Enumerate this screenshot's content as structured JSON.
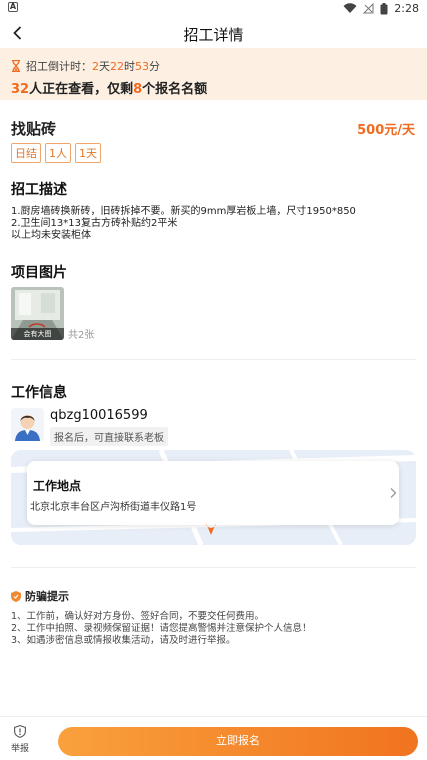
{
  "status_bar": {
    "left_badge": "A",
    "time": "2:28",
    "icons": [
      "wifi-icon",
      "signal-icon",
      "battery-icon"
    ]
  },
  "header": {
    "title": "招工详情",
    "back_icon": "chevron-left-icon"
  },
  "countdown": {
    "label": "招工倒计时：",
    "days": "2",
    "days_unit": "天",
    "hours": "22",
    "hours_unit": "时",
    "minutes": "53",
    "minutes_unit": "分",
    "viewers": "32",
    "viewers_text": "人正在查看，仅剩",
    "remaining": "8",
    "remaining_text": "个报名名额"
  },
  "job": {
    "title": "找贴砖",
    "wage": "500元/天",
    "tags": [
      "日结",
      "1人",
      "1天"
    ]
  },
  "description": {
    "heading": "招工描述",
    "lines": [
      "1.厨房墙砖换新砖，旧砖拆掉不要。新买的9mm厚岩板上墙，尺寸1950*850",
      "2.卫生间13*13复古方砖补贴约2平米",
      "以上均未安装柜体"
    ]
  },
  "photos": {
    "heading": "项目图片",
    "thumb_caption": "会有大图",
    "count": "共2张"
  },
  "work_info": {
    "heading": "工作信息",
    "username": "qbzg10016599",
    "contact_note": "报名后，可直接联系老板",
    "location_title": "工作地点",
    "address": "北京北京丰台区卢沟桥街道丰仪路1号"
  },
  "fraud": {
    "heading": "防骗提示",
    "items": [
      "1、工作前，确认好对方身份、签好合同，不要交任何费用。",
      "2、工作中拍照、录视频保留证据！请您提高警惕并注意保护个人信息！",
      "3、如遇涉密信息或情报收集活动，请及时进行举报。"
    ]
  },
  "bottom": {
    "report_label": "举报",
    "apply_label": "立即报名"
  },
  "colors": {
    "accent": "#f06a1f",
    "banner_bg": "#fdf0e3",
    "button_start": "#f9a13c",
    "button_end": "#f1731f"
  }
}
